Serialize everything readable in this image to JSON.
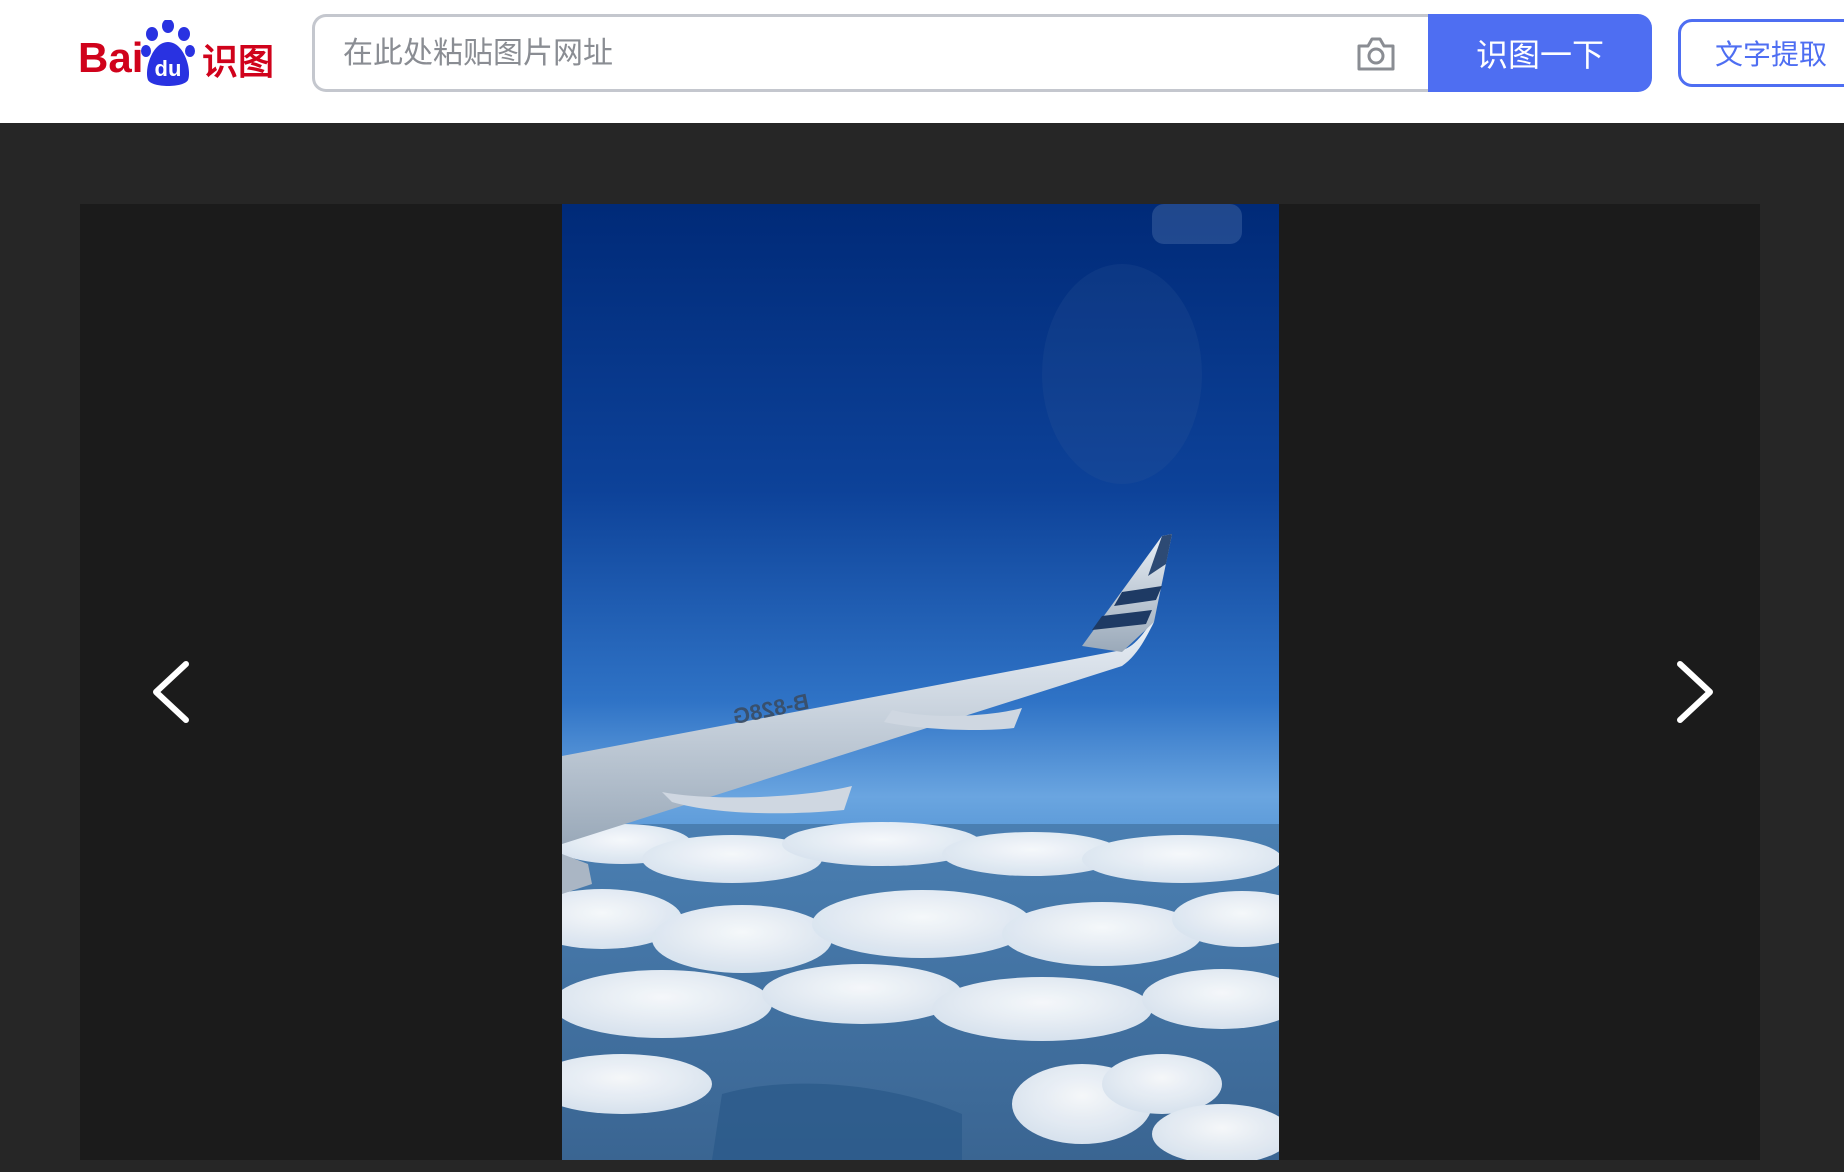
{
  "header": {
    "logo": {
      "brand_text": "Bai",
      "paw_text": "du",
      "product_text": "识图",
      "brand_color": "#d0021b",
      "paw_color": "#2932e1"
    },
    "search": {
      "value": "",
      "placeholder": "在此处粘贴图片网址",
      "camera_icon": "camera-icon"
    },
    "search_button_label": "识图一下",
    "text_extract_label": "文字提取",
    "accent_color": "#4e6ef2"
  },
  "viewer": {
    "prev_icon": "chevron-left-icon",
    "next_icon": "chevron-right-icon",
    "image": {
      "wing_registration": "B-828G",
      "background_color": "#1b1b1b"
    }
  }
}
